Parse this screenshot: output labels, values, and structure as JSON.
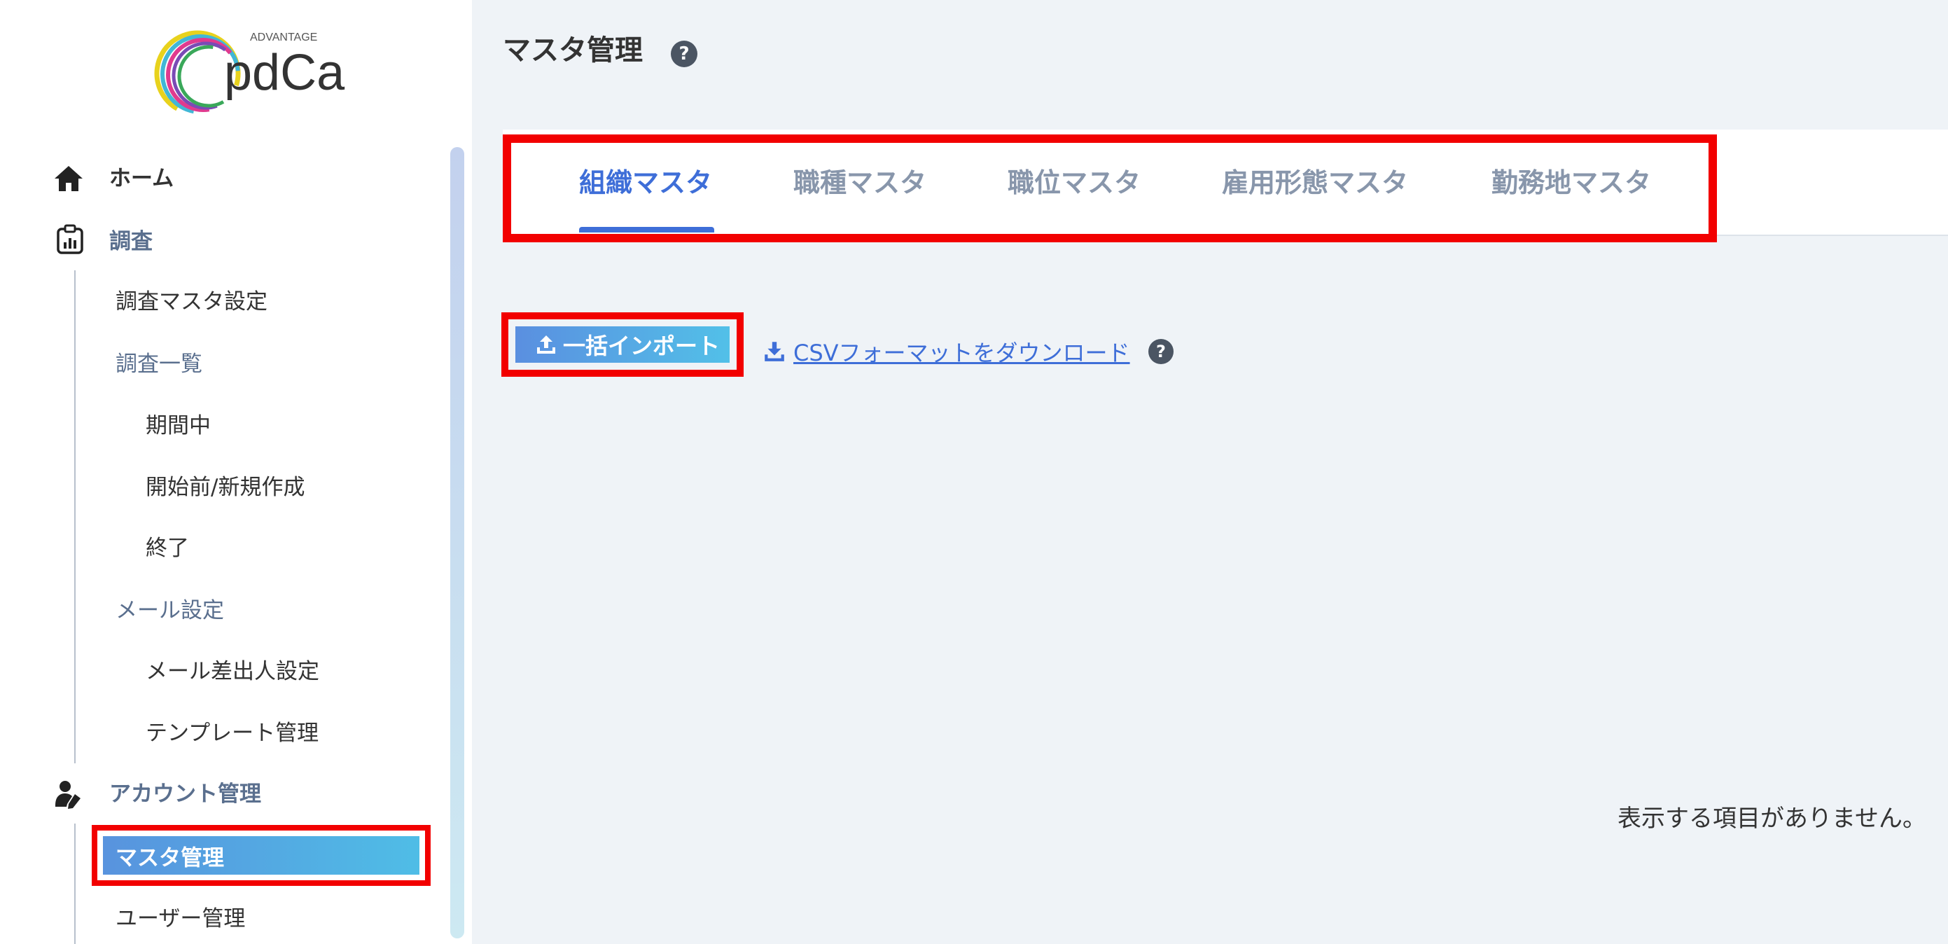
{
  "logo": {
    "small_text": "ADVANTAGE",
    "wordmark": "pdCa"
  },
  "sidebar": {
    "home": {
      "label": "ホーム",
      "icon": "home-icon"
    },
    "survey": {
      "label": "調査",
      "icon": "clipboard-chart-icon",
      "items": {
        "master_settings": "調査マスタ設定",
        "list": "調査一覧",
        "in_progress": "期間中",
        "before_start": "開始前/新規作成",
        "finished": "終了",
        "mail_settings": "メール設定",
        "mail_sender": "メール差出人設定",
        "template": "テンプレート管理"
      }
    },
    "account": {
      "label": "アカウント管理",
      "icon": "user-edit-icon",
      "items": {
        "master": "マスタ管理",
        "users": "ユーザー管理"
      }
    }
  },
  "header": {
    "title": "マスタ管理",
    "help_icon": "question-circle-icon"
  },
  "tabs": [
    {
      "label": "組織マスタ",
      "active": true
    },
    {
      "label": "職種マスタ",
      "active": false
    },
    {
      "label": "職位マスタ",
      "active": false
    },
    {
      "label": "雇用形態マスタ",
      "active": false
    },
    {
      "label": "勤務地マスタ",
      "active": false
    }
  ],
  "actions": {
    "import_label": "一括インポート",
    "import_icon": "upload-icon",
    "csv_label": "CSVフォーマットをダウンロード",
    "csv_icon": "download-icon"
  },
  "empty_message": "表示する項目がありません。",
  "colors": {
    "highlight": "#f20000",
    "accent": "#3e6ed8",
    "button_gradient_start": "#5a8fe0",
    "button_gradient_end": "#52c0e8"
  }
}
